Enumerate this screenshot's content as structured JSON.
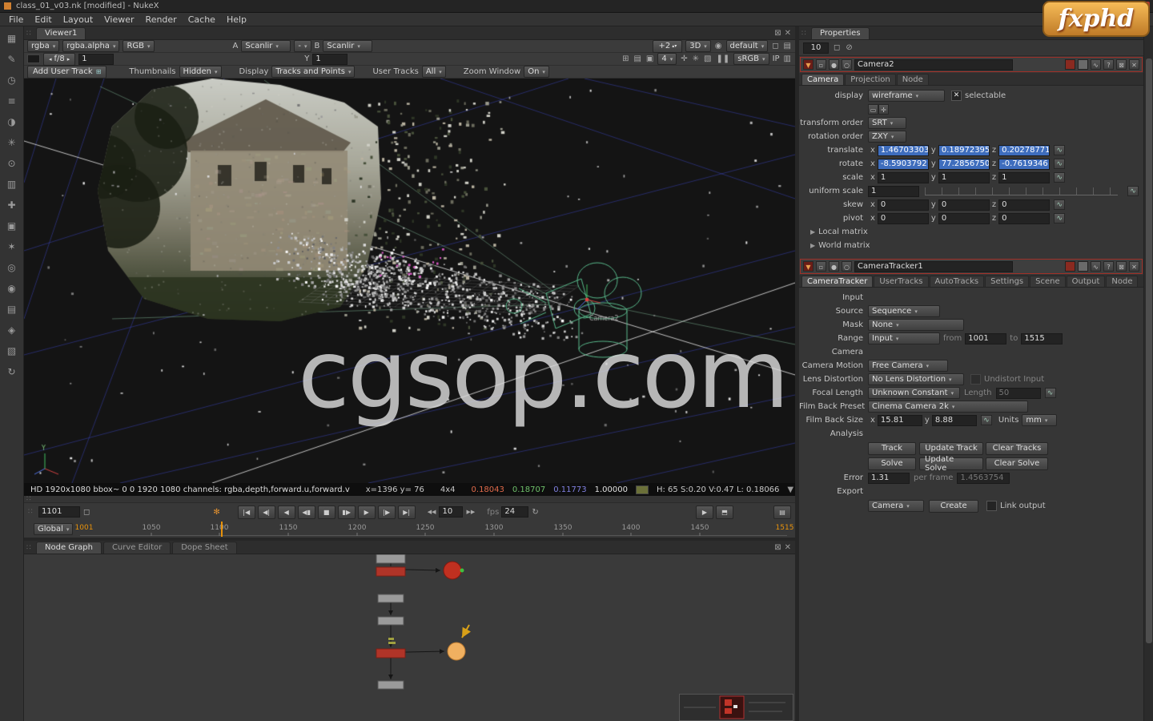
{
  "window": {
    "title": "class_01_v03.nk [modified] - NukeX",
    "menus": [
      "File",
      "Edit",
      "Layout",
      "Viewer",
      "Render",
      "Cache",
      "Help"
    ],
    "logo_text": "fxphd"
  },
  "icons": {
    "app": "▪",
    "min": "–",
    "max": "▢",
    "close": "✕",
    "grip": "∷",
    "float": "⊠",
    "check": "✕",
    "curve": "∿",
    "lock": "◻",
    "cache": "✻",
    "folder": "▭",
    "snap": "✛",
    "camera": "◉",
    "grid": "⊞",
    "rows": "▤",
    "box": "▣",
    "plus": "✛",
    "star": "✳",
    "wipe": "▧",
    "pause": "❚❚",
    "layers": "▥",
    "eraser": "⊘",
    "play": "▶",
    "monitor": "⬒",
    "menu": "▤",
    "expand": "▶",
    "collapse": "▼",
    "help": "?",
    "loop": "↻",
    "skip_back": "◀◀",
    "skip_fwd": "▶▶",
    "spin_l": "◂",
    "spin_r": "▸",
    "updown": "▴▾",
    "dot": "●",
    "sq": "▫",
    "bulb": "○",
    "caret_down": "▼"
  },
  "toolbar_left": {
    "icons": [
      {
        "name": "image",
        "glyph": "▦"
      },
      {
        "name": "draw",
        "glyph": "✎"
      },
      {
        "name": "time",
        "glyph": "◷"
      },
      {
        "name": "channel",
        "glyph": "≡"
      },
      {
        "name": "color",
        "glyph": "◑"
      },
      {
        "name": "filter",
        "glyph": "✳"
      },
      {
        "name": "keyer",
        "glyph": "⊙"
      },
      {
        "name": "merge",
        "glyph": "▥"
      },
      {
        "name": "transform",
        "glyph": "✚"
      },
      {
        "name": "threed",
        "glyph": "▣"
      },
      {
        "name": "particles",
        "glyph": "✶"
      },
      {
        "name": "deep",
        "glyph": "◎"
      },
      {
        "name": "views",
        "glyph": "◉"
      },
      {
        "name": "metadata",
        "glyph": "▤"
      },
      {
        "name": "toolsets",
        "glyph": "◈"
      },
      {
        "name": "plugins",
        "glyph": "▧"
      },
      {
        "name": "refresh",
        "glyph": "↻"
      }
    ]
  },
  "viewer": {
    "tab": "Viewer1",
    "row1": {
      "layer": "rgba",
      "alpha_layer": "rgba.alpha",
      "channels": "RGB",
      "a_label": "A",
      "a_buffer": "Scanlir",
      "blend": "-",
      "b_label": "B",
      "b_buffer": "Scanlir",
      "proxy": "+2",
      "mode": "3D",
      "camera": "default"
    },
    "row2": {
      "fstop": "f/8",
      "gain": "1",
      "gamma_label": "Y",
      "gamma": "1",
      "downrez": "4",
      "colorspace": "sRGB",
      "ip": "IP"
    },
    "row3": {
      "add_user_track": "Add User Track",
      "thumbnails_label": "Thumbnails",
      "thumbnails": "Hidden",
      "display_label": "Display",
      "display": "Tracks and Points",
      "user_tracks_label": "User Tracks",
      "user_tracks": "All",
      "zoom_window_label": "Zoom Window",
      "zoom_window": "On"
    },
    "scene": {
      "camera_label": "Camera2"
    },
    "status": {
      "format": "HD 1920x1080 bbox~ 0 0 1920 1080 channels: rgba,depth,forward.u,forward.v",
      "pointer": "x=1396 y= 76",
      "zoom": "4x4",
      "r": "0.18043",
      "g": "0.18707",
      "b": "0.11773",
      "a": "1.00000",
      "hsvl": "H: 65 S:0.20 V:0.47 L: 0.18066"
    },
    "transport": {
      "frame": "1101",
      "buttons": [
        {
          "name": "goto-start",
          "glyph": "|◀"
        },
        {
          "name": "prev-keyframe",
          "glyph": "◀|"
        },
        {
          "name": "step-back",
          "glyph": "◀"
        },
        {
          "name": "play-backward",
          "glyph": "◀▮"
        },
        {
          "name": "stop",
          "glyph": "■"
        },
        {
          "name": "play-forward",
          "glyph": "▮▶"
        },
        {
          "name": "step-forward",
          "glyph": "▶"
        },
        {
          "name": "next-keyframe",
          "glyph": "|▶"
        },
        {
          "name": "goto-end",
          "glyph": "▶|"
        }
      ],
      "increment": "10",
      "fps_label": "fps",
      "fps": "24"
    },
    "timeline": {
      "mode": "Global",
      "start": "1001",
      "current": "1101",
      "ticks": [
        "1050",
        "1100",
        "1150",
        "1200",
        "1250",
        "1300",
        "1350",
        "1400",
        "1450"
      ],
      "end": "1515"
    }
  },
  "watermark": "cgsop.com",
  "nodegraph": {
    "tabs": [
      "Node Graph",
      "Curve Editor",
      "Dope Sheet"
    ]
  },
  "properties": {
    "tab": "Properties",
    "max_panels": "10",
    "camera": {
      "name": "Camera2",
      "tabs": [
        "Camera",
        "Projection",
        "Node"
      ],
      "rows": {
        "x": "x",
        "y": "y",
        "z": "z",
        "display_label": "display",
        "display": "wireframe",
        "selectable": "selectable",
        "transform_order_label": "transform order",
        "transform_order": "SRT",
        "rotation_order_label": "rotation order",
        "rotation_order": "ZXY",
        "translate_label": "translate",
        "tx": "1.46703303",
        "ty": "0.18972395",
        "tz": "0.20278771",
        "rotate_label": "rotate",
        "rx": "-8.5903792",
        "ry": "77.2856750",
        "rz": "-0.7619346",
        "scale_label": "scale",
        "sx": "1",
        "sy": "1",
        "sz": "1",
        "uniform_label": "uniform scale",
        "uniform": "1",
        "skew_label": "skew",
        "kx": "0",
        "ky": "0",
        "kz": "0",
        "pivot_label": "pivot",
        "px": "0",
        "py": "0",
        "pz": "0",
        "local_matrix": "Local matrix",
        "world_matrix": "World matrix"
      }
    },
    "tracker": {
      "name": "CameraTracker1",
      "tabs": [
        "CameraTracker",
        "UserTracks",
        "AutoTracks",
        "Settings",
        "Scene",
        "Output",
        "Node"
      ],
      "rows": {
        "x": "x",
        "y": "y",
        "input_section": "Input",
        "source_label": "Source",
        "source": "Sequence",
        "mask_label": "Mask",
        "mask": "None",
        "range_label": "Range",
        "range": "Input",
        "from_label": "from",
        "from": "1001",
        "to_label": "to",
        "to": "1515",
        "camera_section": "Camera",
        "camera_motion_label": "Camera Motion",
        "camera_motion": "Free Camera",
        "lens_label": "Lens Distortion",
        "lens": "No Lens Distortion",
        "undistort": "Undistort Input",
        "focal_label": "Focal Length",
        "focal": "Unknown Constant",
        "length_label": "Length",
        "length": "50",
        "film_preset_label": "Film Back Preset",
        "film_preset": "Cinema Camera 2k",
        "film_size_label": "Film Back Size",
        "fb_x": "15.81",
        "fb_y": "8.88",
        "units_label": "Units",
        "units": "mm",
        "analysis_section": "Analysis",
        "track": "Track",
        "update_track": "Update Track",
        "clear_tracks": "Clear Tracks",
        "solve": "Solve",
        "update_solve": "Update Solve",
        "clear_solve": "Clear Solve",
        "error_label": "Error",
        "error": "1.31",
        "per_frame_label": "per frame",
        "per_frame": "1.4563754",
        "export_section": "Export",
        "export_type": "Camera",
        "create": "Create",
        "link_output": "Link output"
      }
    }
  },
  "colors": {
    "selection_blue": "#3e6dbd",
    "accent_orange": "#e8920a",
    "panel_red": "#a03028",
    "wire_green": "#58b98b"
  }
}
